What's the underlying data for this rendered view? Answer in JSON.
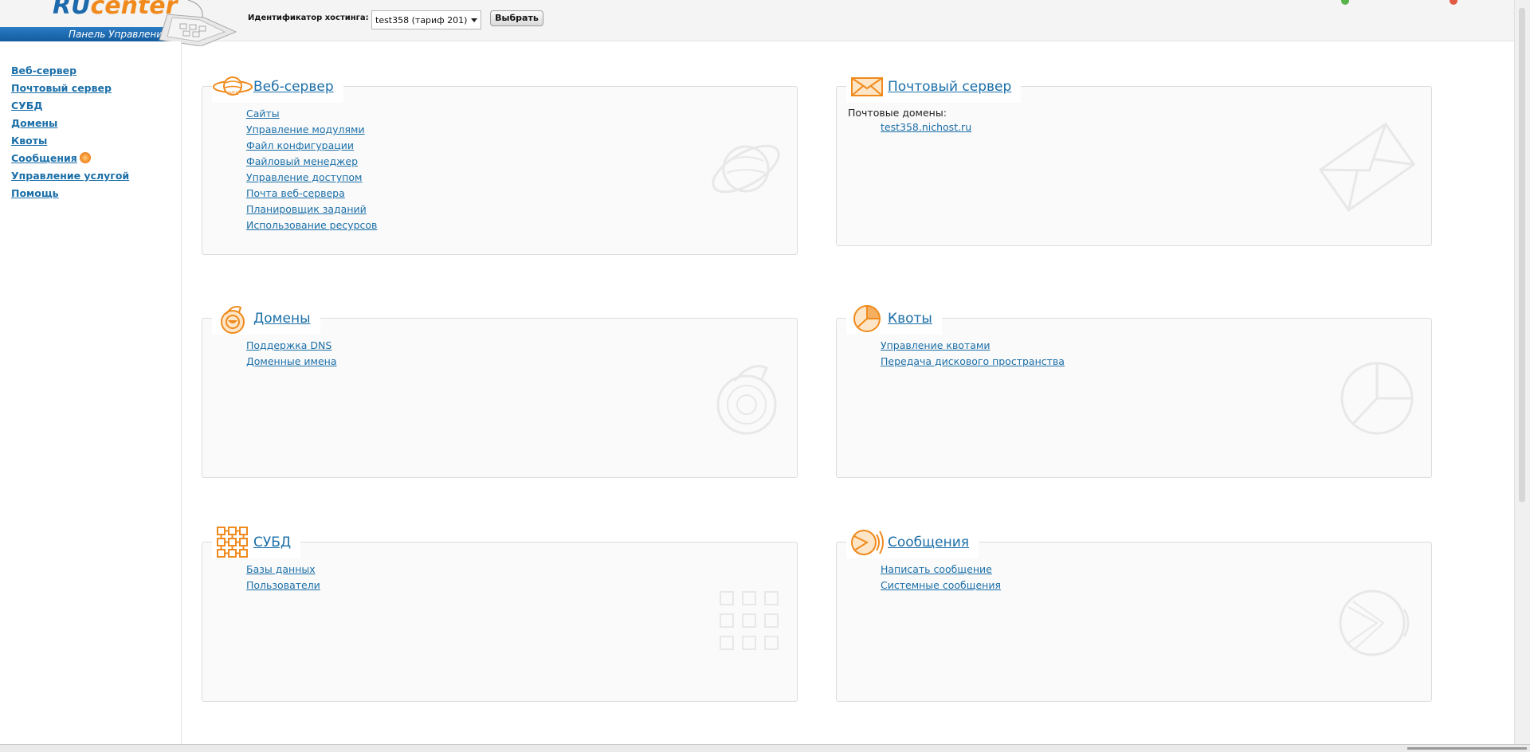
{
  "header": {
    "logo": {
      "ru": "RU",
      "center": "center",
      "subtitle": "Панель Управления"
    },
    "hosting_label": "Идентификатор хостинга:",
    "hosting_value": "test358  (тариф 201)",
    "select_button": "Выбрать"
  },
  "sidebar": {
    "items": [
      {
        "label": "Веб-сервер"
      },
      {
        "label": "Почтовый сервер"
      },
      {
        "label": "СУБД"
      },
      {
        "label": "Домены"
      },
      {
        "label": "Квоты"
      },
      {
        "label": "Сообщения",
        "icon": "notification-sun-icon"
      },
      {
        "label": "Управление услугой"
      },
      {
        "label": "Помощь"
      }
    ]
  },
  "panels": {
    "web": {
      "title": "Веб-сервер",
      "icon": "planet-icon",
      "links": [
        "Сайты",
        "Управление модулями",
        "Файл конфигурации",
        "Файловый менеджер",
        "Управление доступом",
        "Почта веб-сервера",
        "Планировщик заданий",
        "Использование ресурсов"
      ]
    },
    "mail": {
      "title": "Почтовый сервер",
      "icon": "envelope-icon",
      "domains_label": "Почтовые домены:",
      "domain": "test358.nichost.ru"
    },
    "domains": {
      "title": "Домены",
      "icon": "domain-mascot-icon",
      "links": [
        "Поддержка DNS",
        "Доменные имена"
      ]
    },
    "quotas": {
      "title": "Квоты",
      "icon": "pie-chart-icon",
      "links": [
        "Управление квотами",
        "Передача дискового пространства"
      ]
    },
    "dbms": {
      "title": "СУБД",
      "icon": "grid-icon",
      "links": [
        "Базы данных",
        "Пользователи"
      ]
    },
    "messages": {
      "title": "Сообщения",
      "icon": "satellite-icon",
      "links": [
        "Написать сообщение",
        "Системные сообщения"
      ]
    }
  },
  "colors": {
    "accent": "#f08a1c",
    "link": "#1b6fa8",
    "brand_blue": "#1c6aab"
  }
}
